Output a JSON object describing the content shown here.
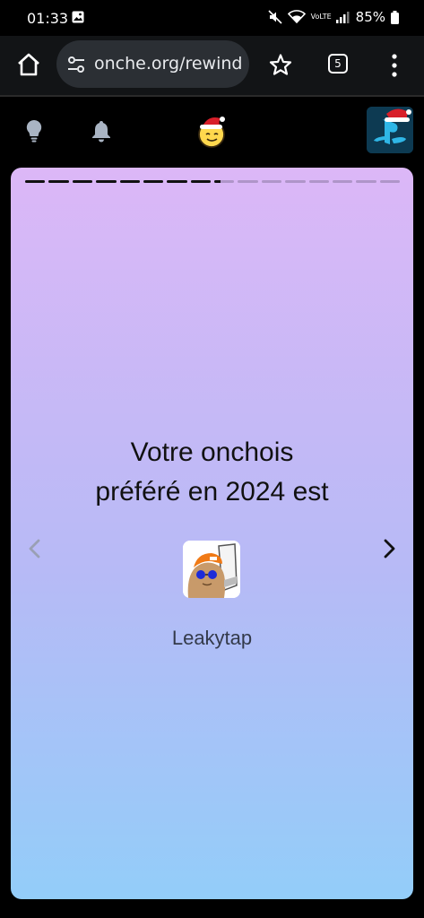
{
  "status_bar": {
    "time": "01:33",
    "lte_label": "VoLTE",
    "battery": "85%"
  },
  "browser": {
    "url": "onche.org/rewind",
    "tab_count": "5"
  },
  "card": {
    "progress": {
      "segments": 16,
      "completed": 8,
      "current_fill": 0.3
    },
    "title_line1": "Votre onchois",
    "title_line2": "préféré en 2024 est",
    "username": "Leakytap"
  },
  "colors": {
    "card_gradient_top": "#dcb7f7",
    "card_gradient_bottom": "#93cdf9",
    "title_text": "#111111"
  },
  "icons": {
    "home": "home-icon",
    "tune": "tune-icon",
    "star": "star-icon",
    "menu": "more-vert-icon",
    "bulb": "lightbulb-icon",
    "bell": "bell-icon",
    "mascot": "santa-mascot-icon",
    "profile": "playstation-avatar-icon",
    "prev": "chevron-left-icon",
    "next": "chevron-right-icon"
  }
}
